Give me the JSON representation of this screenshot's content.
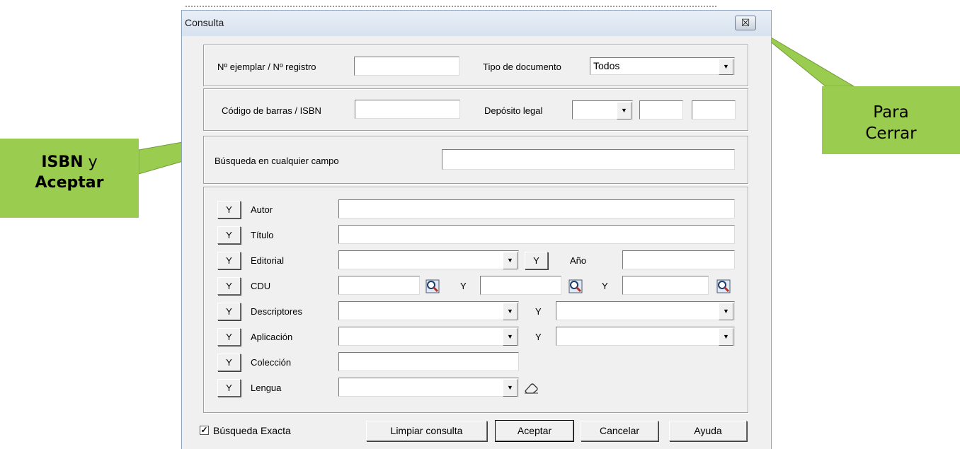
{
  "dialog": {
    "title": "Consulta",
    "close_glyph": "☒"
  },
  "row1": {
    "ejemplar_label": "Nº ejemplar / Nº registro",
    "ejemplar_value": "",
    "tipo_label": "Tipo de documento",
    "tipo_value": "Todos"
  },
  "row2": {
    "codigo_label": "Código de barras / ISBN",
    "codigo_value": "",
    "deposito_label": "Depósito legal"
  },
  "row3": {
    "busqueda_label": "Búsqueda en cualquier campo",
    "busqueda_value": ""
  },
  "fields": {
    "and_label": "Y",
    "autor": "Autor",
    "titulo": "Título",
    "editorial": "Editorial",
    "anio": "Año",
    "cdu": "CDU",
    "descriptores": "Descriptores",
    "aplicacion": "Aplicación",
    "coleccion": "Colección",
    "lengua": "Lengua"
  },
  "footer": {
    "exacta_label": "Búsqueda Exacta",
    "exacta_checked": true,
    "limpiar": "Limpiar consulta",
    "aceptar": "Aceptar",
    "cancelar": "Cancelar",
    "ayuda": "Ayuda"
  },
  "callouts": {
    "left_bold": "ISBN",
    "left_y": " y",
    "left_line2": "Aceptar",
    "right_line1": "Para",
    "right_line2": "Cerrar"
  },
  "colors": {
    "callout": "#9acd4f",
    "dialog_bg": "#f0f0f0"
  }
}
